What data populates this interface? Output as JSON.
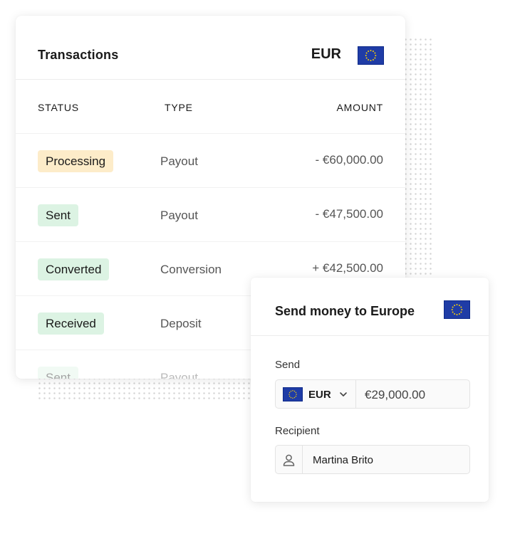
{
  "transactions": {
    "title": "Transactions",
    "currency": "EUR",
    "flag_icon": "eu-flag-icon",
    "columns": {
      "status": "STATUS",
      "type": "TYPE",
      "amount": "AMOUNT"
    },
    "rows": [
      {
        "status": "Processing",
        "status_color": "#fdecc9",
        "type": "Payout",
        "amount": "- €60,000.00"
      },
      {
        "status": "Sent",
        "status_color": "#dcf3e3",
        "type": "Payout",
        "amount": "- €47,500.00"
      },
      {
        "status": "Converted",
        "status_color": "#dcf3e3",
        "type": "Conversion",
        "amount": "+ €42,500.00"
      },
      {
        "status": "Received",
        "status_color": "#dcf3e3",
        "type": "Deposit",
        "amount": ""
      },
      {
        "status": "Sent",
        "status_color": "#dcf3e3",
        "type": "Payout",
        "amount": ""
      }
    ]
  },
  "send_money": {
    "title": "Send money to Europe",
    "flag_icon": "eu-flag-icon",
    "send_label": "Send",
    "currency": "EUR",
    "amount": "€29,000.00",
    "recipient_label": "Recipient",
    "recipient_name": "Martina Brito"
  },
  "colors": {
    "flag_blue": "#1f3ca6",
    "flag_star": "#ffd200",
    "badge_orange": "#fdecc9",
    "badge_green": "#dcf3e3"
  }
}
